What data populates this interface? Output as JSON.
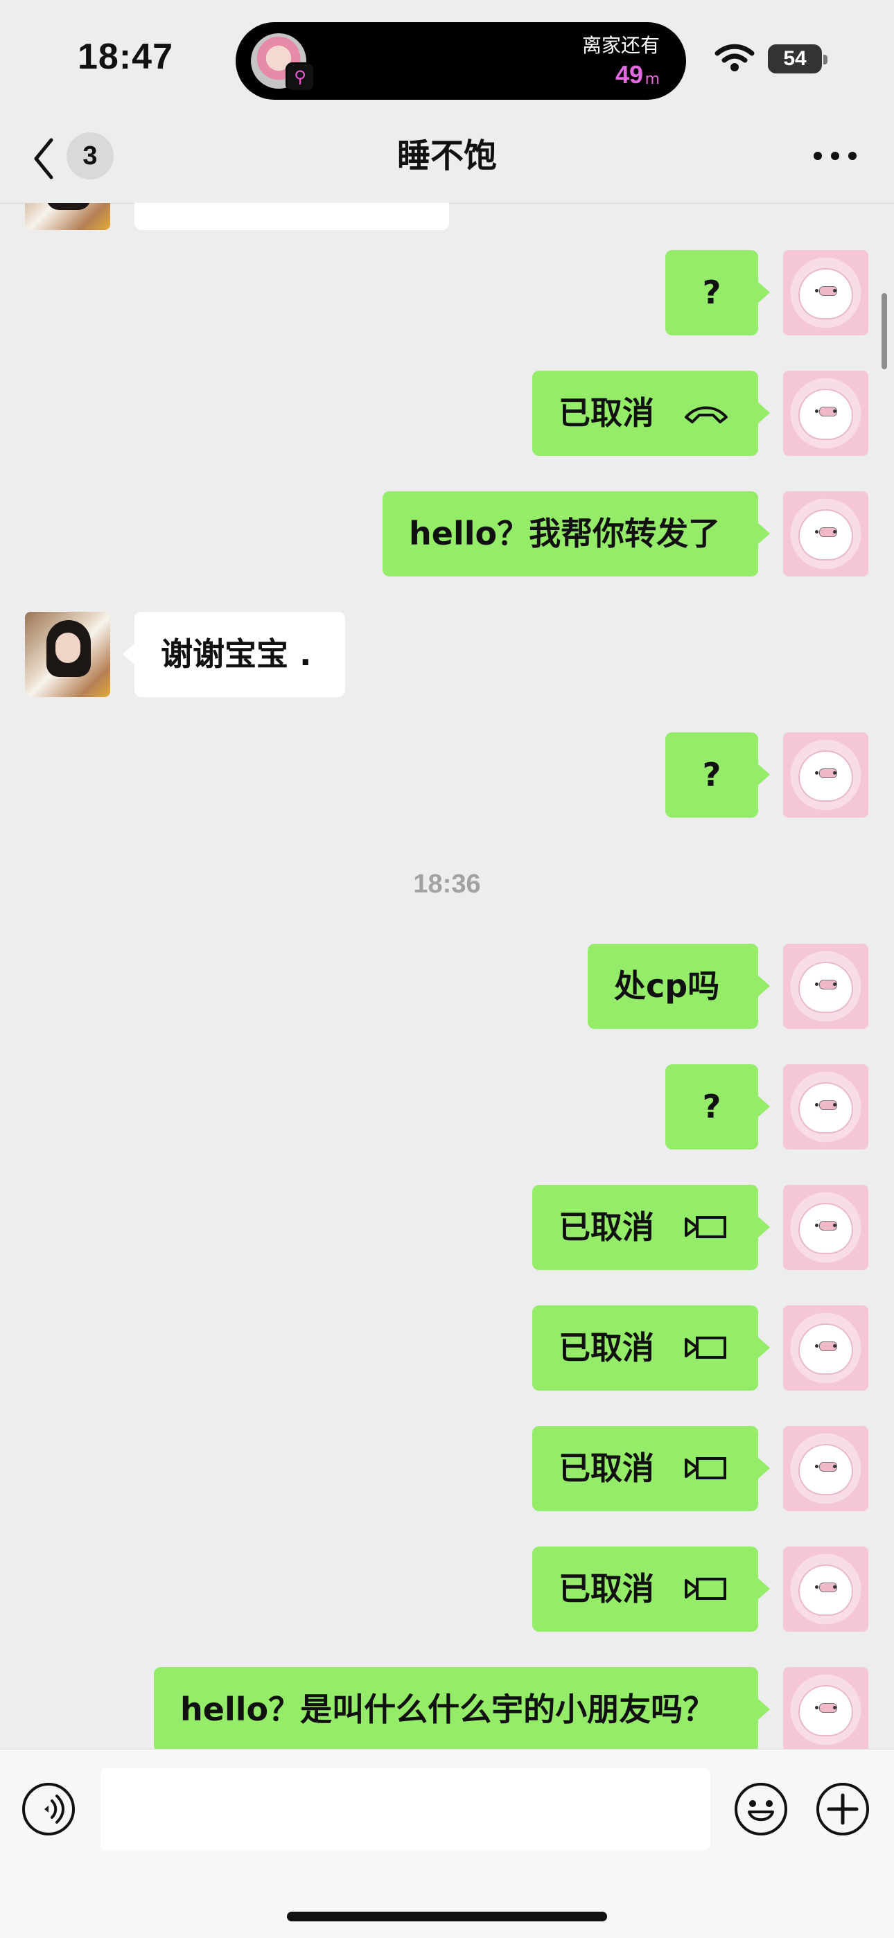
{
  "status_bar": {
    "time": "18:47",
    "activity_label": "离家还有",
    "activity_value": "49",
    "activity_unit": "m",
    "battery": "54",
    "battery_level": 0.54
  },
  "header": {
    "unread_count": "3",
    "title": "睡不饱"
  },
  "messages": [
    {
      "sender": "me",
      "text": "?"
    },
    {
      "sender": "me",
      "text": "已取消",
      "icon": "phone-icon"
    },
    {
      "sender": "me",
      "text": "hello？我帮你转发了"
    },
    {
      "sender": "friend",
      "text": "谢谢宝宝 ."
    },
    {
      "sender": "me",
      "text": "?"
    },
    {
      "sender": "me",
      "text": "处cp吗"
    },
    {
      "sender": "me",
      "text": "?"
    },
    {
      "sender": "me",
      "text": "已取消",
      "icon": "video-call-icon"
    },
    {
      "sender": "me",
      "text": "已取消",
      "icon": "video-call-icon"
    },
    {
      "sender": "me",
      "text": "已取消",
      "icon": "video-call-icon"
    },
    {
      "sender": "me",
      "text": "已取消",
      "icon": "video-call-icon"
    },
    {
      "sender": "me",
      "text": "hello？是叫什么什么宇的小朋友吗？"
    }
  ],
  "timestamp": "18:36",
  "input": {
    "value": "",
    "placeholder": ""
  },
  "colors": {
    "background": "#ededed",
    "my_bubble": "#95ec69",
    "friend_bubble": "#ffffff",
    "activity_accent": "#e46ae0"
  }
}
